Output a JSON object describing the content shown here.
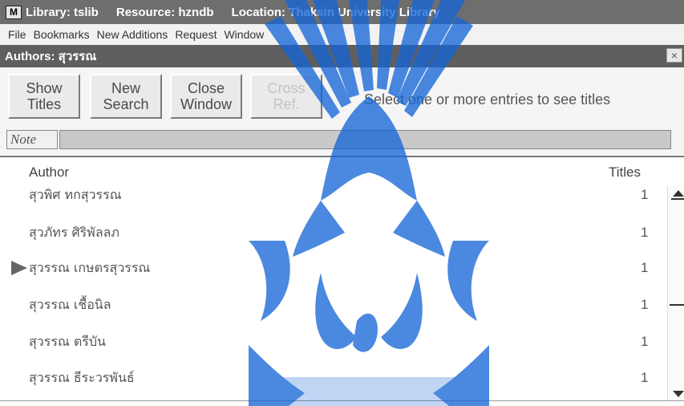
{
  "titlebar": {
    "library": "Library: tslib",
    "resource": "Resource: hzndb",
    "location": "Location: Thaksin University Library"
  },
  "menu": [
    "File",
    "Bookmarks",
    "New Additions",
    "Request",
    "Window"
  ],
  "window": {
    "title": "Authors: สุวรรณ",
    "close": "×"
  },
  "toolbar": {
    "show_titles": [
      "Show",
      "Titles"
    ],
    "new_search": [
      "New",
      "Search"
    ],
    "close_window": [
      "Close",
      "Window"
    ],
    "cross_ref": [
      "Cross",
      "Ref."
    ],
    "message": "Select one or more entries to see titles"
  },
  "note": {
    "label": "Note",
    "value": ""
  },
  "list": {
    "header_author": "Author",
    "header_titles": "Titles",
    "rows": [
      {
        "author": "สุวพิศ ทกสุวรรณ",
        "titles": "1"
      },
      {
        "author": "สุวภัทร ศิริพัลลภ",
        "titles": "1"
      },
      {
        "author": "สุวรรณ เกษตรสุวรรณ",
        "titles": "1"
      },
      {
        "author": "สุวรรณ เชื้อนิล",
        "titles": "1"
      },
      {
        "author": "สุวรรณ ตรีบัน",
        "titles": "1"
      },
      {
        "author": "สุวรรณ ธีระวรพันธ์",
        "titles": "1"
      }
    ],
    "current_row": 2
  },
  "colors": {
    "watermark": "#1565d8",
    "titlebar": "#6e6e6e"
  },
  "icons": {
    "app": "library-app-icon",
    "pointer": "current-row-pointer-icon",
    "watermark": "university-emblem-watermark"
  }
}
